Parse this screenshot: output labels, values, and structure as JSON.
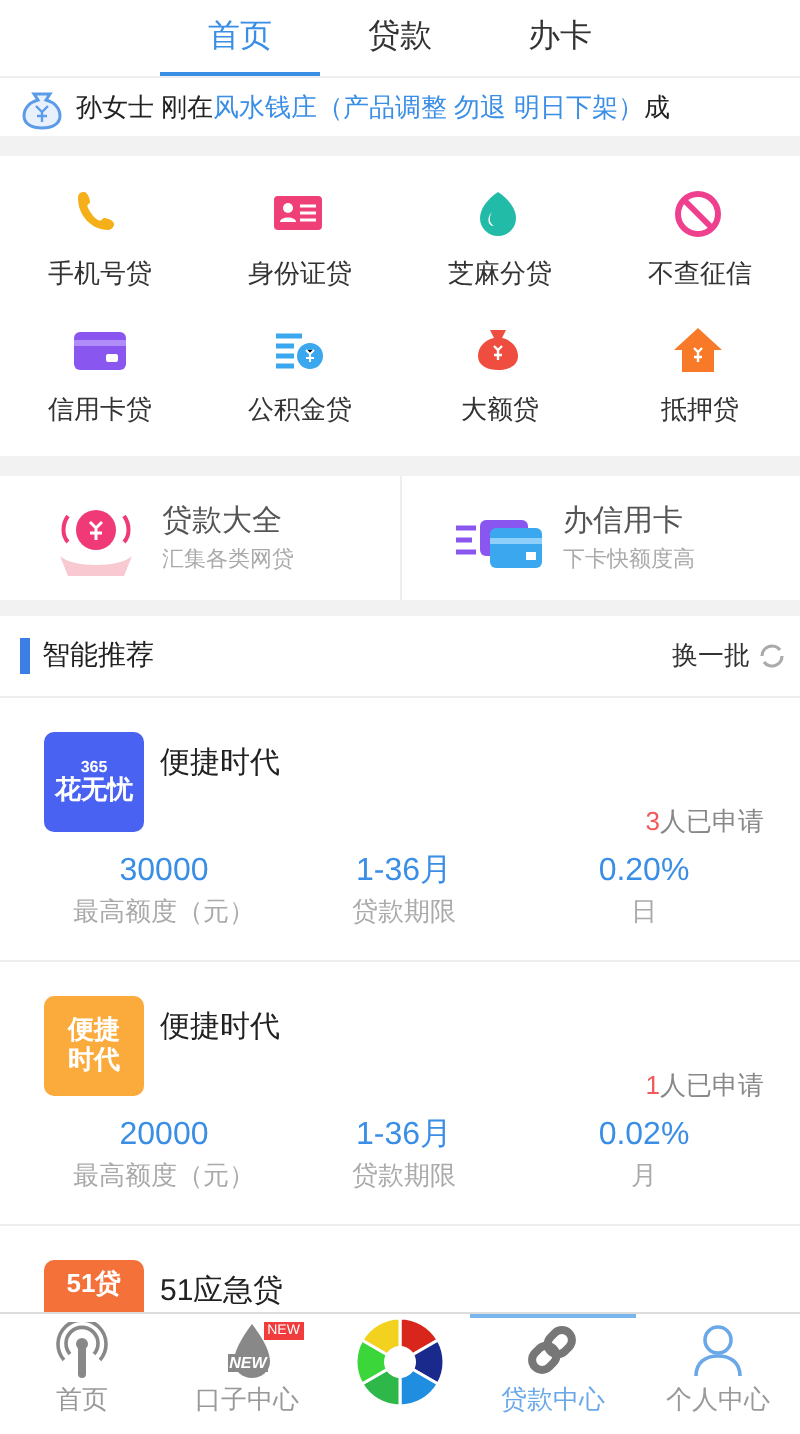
{
  "top_tabs": [
    {
      "label": "首页",
      "selected": true
    },
    {
      "label": "贷款",
      "selected": false
    },
    {
      "label": "办卡",
      "selected": false
    }
  ],
  "ticker": {
    "parts": [
      {
        "text": "孙女士 刚在",
        "highlight": false
      },
      {
        "text": "风水钱庄（产品调整 勿退 明日下架）",
        "highlight": true
      },
      {
        "text": "成",
        "highlight": false
      }
    ]
  },
  "categories": [
    {
      "label": "手机号贷"
    },
    {
      "label": "身份证贷"
    },
    {
      "label": "芝麻分贷"
    },
    {
      "label": "不查征信"
    },
    {
      "label": "信用卡贷"
    },
    {
      "label": "公积金贷"
    },
    {
      "label": "大额贷"
    },
    {
      "label": "抵押贷"
    }
  ],
  "banners": [
    {
      "title": "贷款大全",
      "subtitle": "汇集各类网贷"
    },
    {
      "title": "办信用卡",
      "subtitle": "下卡快额度高"
    }
  ],
  "recommend": {
    "title": "智能推荐",
    "refresh": "换一批"
  },
  "products": [
    {
      "name": "便捷时代",
      "logo_text": [
        "365",
        "花无忧"
      ],
      "color": "#4a62f2",
      "applicants": "3",
      "applicants_suffix": "人已申请",
      "stats": [
        {
          "value": "30000",
          "label": "最高额度（元）"
        },
        {
          "value": "1-36月",
          "label": "贷款期限"
        },
        {
          "value": "0.20%",
          "label": "日"
        }
      ]
    },
    {
      "name": "便捷时代",
      "logo_text": [
        "便捷",
        "时代"
      ],
      "color": "#fbaa3c",
      "applicants": "1",
      "applicants_suffix": "人已申请",
      "stats": [
        {
          "value": "20000",
          "label": "最高额度（元）"
        },
        {
          "value": "1-36月",
          "label": "贷款期限"
        },
        {
          "value": "0.02%",
          "label": "月"
        }
      ]
    },
    {
      "name": "51应急贷",
      "logo_text": [
        "51贷"
      ],
      "color": "#f4713a"
    }
  ],
  "bottom_nav": [
    {
      "kind": "tab",
      "label": "首页",
      "selected": false
    },
    {
      "kind": "tab",
      "label": "口子中心",
      "selected": false,
      "badge": "NEW",
      "icon_text": "NEW"
    },
    {
      "kind": "center"
    },
    {
      "kind": "tab",
      "label": "贷款中心",
      "selected": true
    },
    {
      "kind": "tab",
      "label": "个人中心",
      "selected": false
    }
  ]
}
